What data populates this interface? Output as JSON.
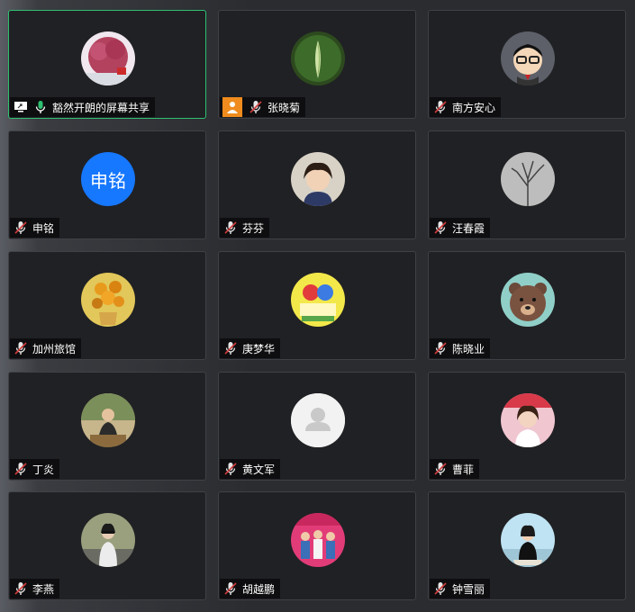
{
  "tiles": [
    {
      "name": "豁然开朗的屏幕共享",
      "share": true,
      "mic": "on"
    },
    {
      "name": "张晓菊",
      "host_icon": true,
      "mic": "off"
    },
    {
      "name": "南方安心",
      "mic": "off"
    },
    {
      "name": "申铭",
      "avatar_text": "申铭",
      "mic": "off"
    },
    {
      "name": "芬芬",
      "mic": "off"
    },
    {
      "name": "汪春霞",
      "mic": "off"
    },
    {
      "name": "加州旅馆",
      "mic": "off"
    },
    {
      "name": "庚梦华",
      "mic": "off"
    },
    {
      "name": "陈晓业",
      "mic": "off"
    },
    {
      "name": "丁炎",
      "mic": "off"
    },
    {
      "name": "黄文军",
      "mic": "off"
    },
    {
      "name": "曹菲",
      "mic": "off"
    },
    {
      "name": "李燕",
      "mic": "off"
    },
    {
      "name": "胡越鹏",
      "mic": "off"
    },
    {
      "name": "钟雪丽",
      "mic": "off"
    }
  ],
  "colors": {
    "active_border": "#2fbf71",
    "mic_on": "#2fbf71",
    "mic_off": "#e6e6e6",
    "user_badge": "#f08c1e",
    "text_avatar_bg": "#1677ff"
  }
}
